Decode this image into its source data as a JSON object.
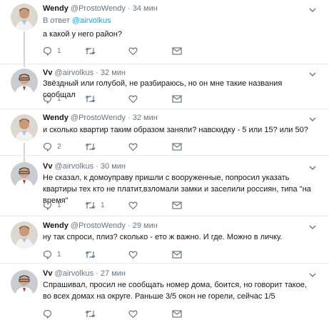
{
  "thread": {
    "tweets": [
      {
        "name": "Wendy",
        "handle": "@ProstoWendy",
        "time": "34 мин",
        "reply_prefix": "В ответ",
        "reply_mention": "@airvolkus",
        "text": "а какой у него район?",
        "replies": "1",
        "retweets": "",
        "likes": "",
        "avatar": "wendy"
      },
      {
        "name": "Vv",
        "handle": "@airvolkus",
        "time": "32 мин",
        "text": "Звёздный или голубой, не разбираюсь, но он мне такие названия сообщал",
        "replies": "1",
        "retweets": "",
        "likes": "",
        "avatar": "vv"
      },
      {
        "name": "Wendy",
        "handle": "@ProstoWendy",
        "time": "32 мин",
        "text": "и сколько квартир таким образом заняли? навскидку - 5 или 15? или 50?",
        "replies": "2",
        "retweets": "",
        "likes": "",
        "avatar": "wendy"
      },
      {
        "name": "Vv",
        "handle": "@airvolkus",
        "time": "30 мин",
        "text": "Не сказал, к домоуправу пришли с вооруженные, попросил указать квартиры тех кто не платит,взломали замки и заселили россиян, типа \"на время\"",
        "replies": "1",
        "retweets": "1",
        "likes": "",
        "avatar": "vv"
      },
      {
        "name": "Wendy",
        "handle": "@ProstoWendy",
        "time": "29 мин",
        "text": "ну так спроси, плиз? сколько - ето ж важно. И где. Можно в личку.",
        "replies": "1",
        "retweets": "",
        "likes": "",
        "avatar": "wendy"
      },
      {
        "name": "Vv",
        "handle": "@airvolkus",
        "time": "27 мин",
        "text": "Спрашивал, просил не сообщать номер дома, боится, но говорит такое, во всех домах на округе. Раньше 3/5 окон не горели, сейчас 1/5",
        "replies": "",
        "retweets": "",
        "likes": "",
        "avatar": "vv"
      }
    ]
  },
  "icons": {
    "reply": "speech-bubble-icon",
    "retweet": "retweet-arrows-icon",
    "like": "heart-icon",
    "dm": "envelope-icon",
    "more": "chevron-down-icon"
  },
  "colors": {
    "text": "#14171a",
    "muted": "#657786",
    "link": "#1da1f2",
    "thread_line": "#ccd6dd",
    "divider": "#e6ecf0"
  }
}
